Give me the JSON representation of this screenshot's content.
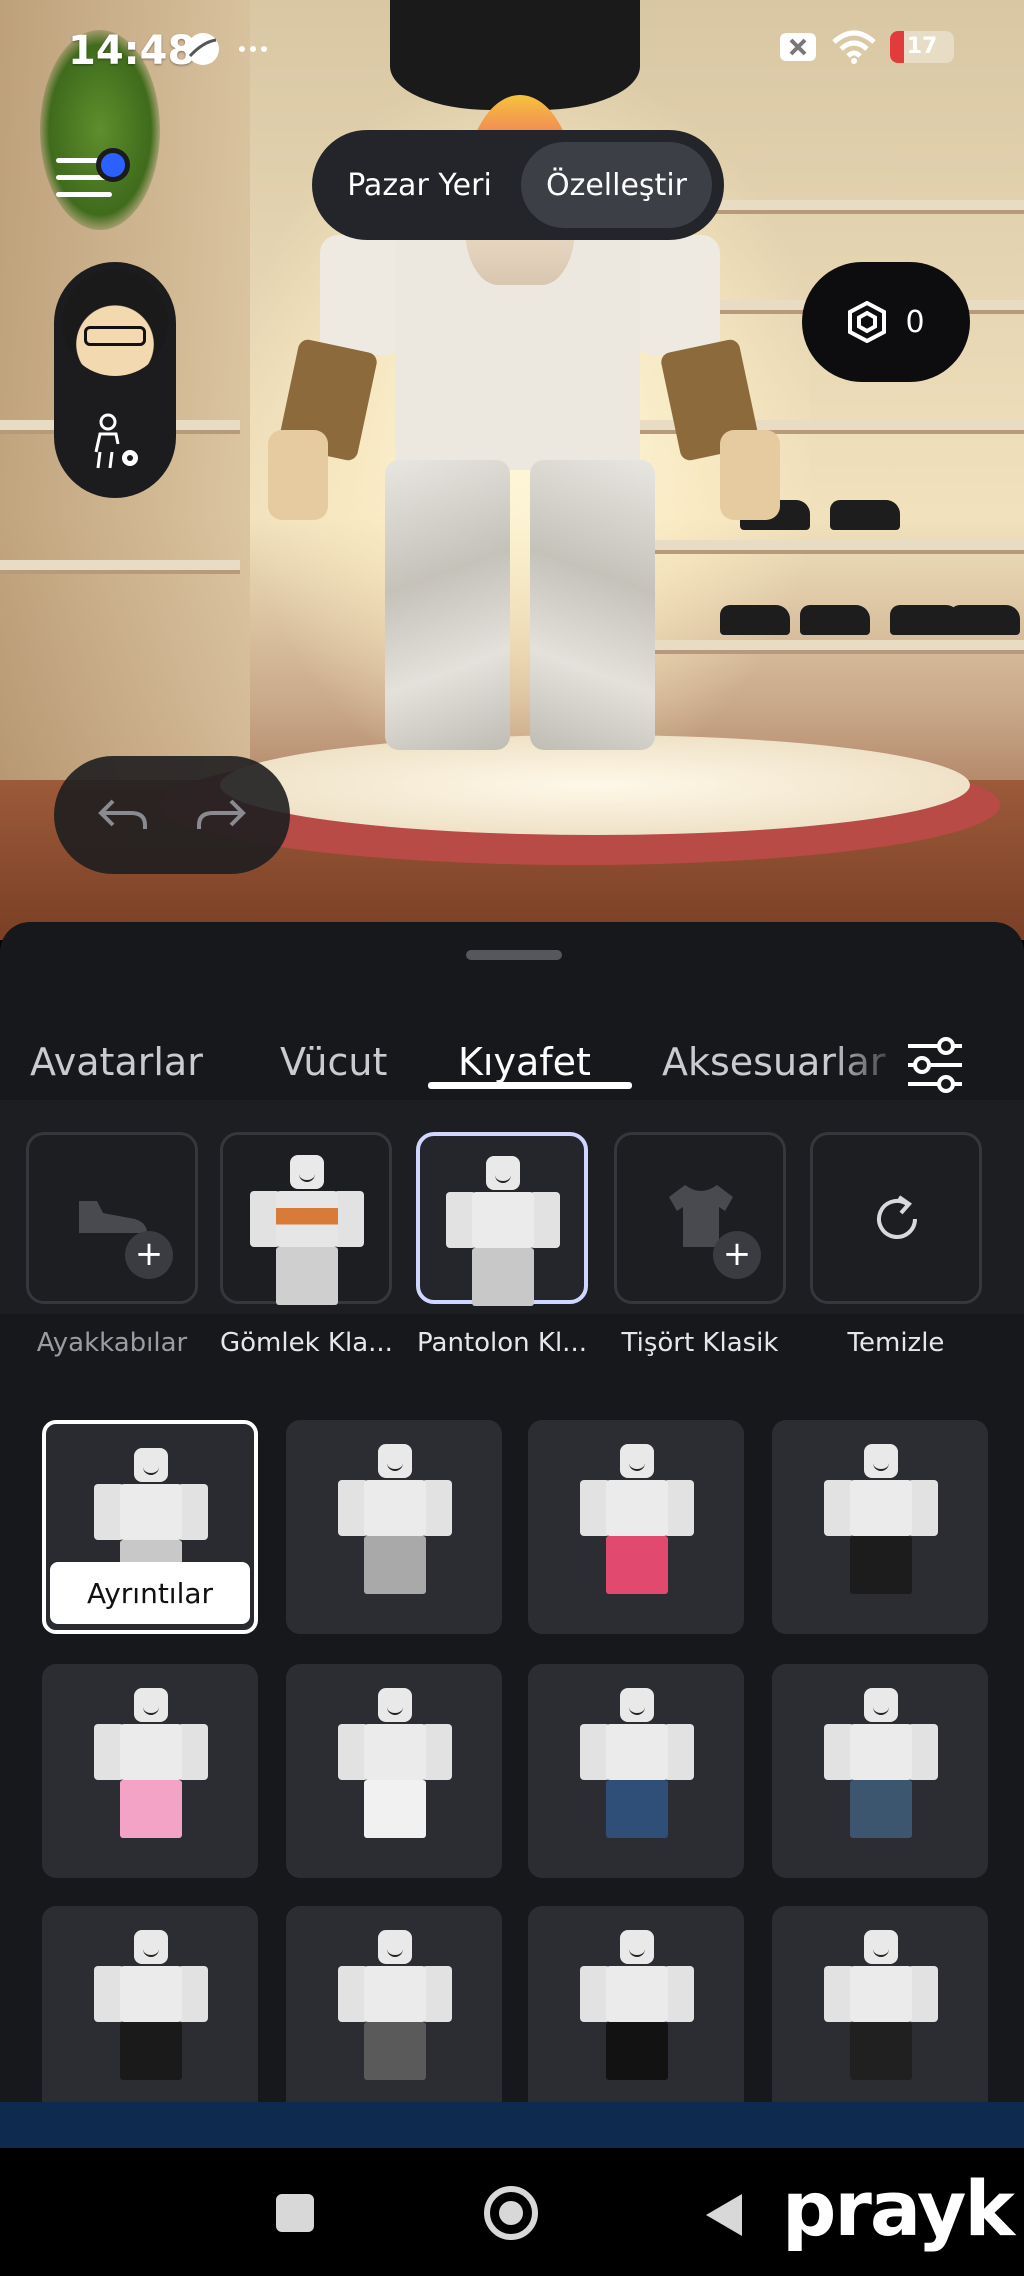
{
  "status_bar": {
    "time": "14:48",
    "battery_level": "17"
  },
  "top_segment": {
    "items": [
      "Pazar Yeri",
      "Özelleştir"
    ],
    "active_index": 1
  },
  "robux": {
    "balance": "0"
  },
  "tabs": {
    "items": [
      "Avatarlar",
      "Vücut",
      "Kıyafet",
      "Aksesuarlar"
    ],
    "active": "Kıyafet"
  },
  "subcategories": [
    {
      "label": "Ayakkabılar",
      "icon": "shoe-add-icon"
    },
    {
      "label": "Gömlek Kla...",
      "icon": "shirt-thumbnail"
    },
    {
      "label": "Pantolon Kl...",
      "icon": "pants-thumbnail",
      "selected": true
    },
    {
      "label": "Tişört Klasik",
      "icon": "tshirt-add-icon"
    },
    {
      "label": "Temizle",
      "icon": "refresh-icon"
    }
  ],
  "grid": {
    "details_label": "Ayrıntılar",
    "items": [
      {
        "legs": "#c8c8c8",
        "selected": true
      },
      {
        "legs": "#a9a9a9"
      },
      {
        "legs": "#e14a6e"
      },
      {
        "legs": "#1c1c1c"
      },
      {
        "legs": "#f2a3c6"
      },
      {
        "legs": "#f1f1f1"
      },
      {
        "legs": "#2f4e78"
      },
      {
        "legs": "#3c5670"
      },
      {
        "legs": "#1a1a1a"
      },
      {
        "legs": "#5a5a5a"
      },
      {
        "legs": "#121212"
      },
      {
        "legs": "#202020"
      }
    ]
  },
  "watermark": {
    "text": "prayk"
  }
}
